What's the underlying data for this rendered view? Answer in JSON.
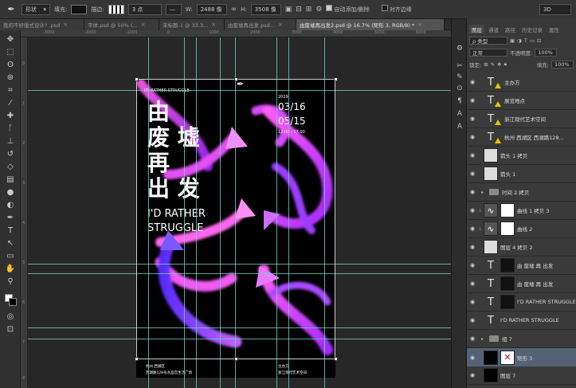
{
  "options_bar": {
    "tool_label": "形状",
    "fill_label": "填充:",
    "stroke_label": "描边:",
    "stroke_width": "3 点",
    "w_label": "W:",
    "w_value": "2488 像",
    "h_label": "H:",
    "h_value": "3508 像",
    "auto_add_label": "自动添加/删除",
    "align_edges_label": "对齐边缘",
    "workspace": "3D"
  },
  "tabs": [
    {
      "label": "我的不好版式设计? .psd",
      "active": false
    },
    {
      "label": "字体.psd @ 50% (...",
      "active": false
    },
    {
      "label": "未标题-1 @ 33.3...",
      "active": false
    },
    {
      "label": "由废墟再出发.psd...",
      "active": false
    },
    {
      "label": "由废墟再出发2.psd @ 16.7% (矩形 3, RGB/8) *",
      "active": true
    }
  ],
  "rulers": {
    "top": [
      "-3000",
      "-2000",
      "-1000",
      "0",
      "1000",
      "2000",
      "3000",
      "4000",
      "5000",
      "6000"
    ],
    "left": [
      "0",
      "1",
      "2",
      "3",
      "4",
      "5",
      "6",
      "7",
      "8"
    ]
  },
  "poster": {
    "tag": "I'D RATHER STRUGGLE",
    "title_lines": [
      "由",
      "废 墟",
      "再",
      "出 发"
    ],
    "english_1": "I'D RATHER",
    "english_2": "STRUGGLE",
    "year": "2019",
    "date_1": "03/16",
    "date_2": "05/15",
    "time": "12:00 - 17:00",
    "foot_left_1": "杭州 西湖区",
    "foot_left_2": "西湖路128号水晶宫生活广场",
    "foot_right_1": "主办方",
    "foot_right_2": "浙江现代艺术空间"
  },
  "panel": {
    "top_dropdown": "3D",
    "tabs": [
      "图层",
      "通道",
      "路径",
      "历史记录",
      "属性"
    ],
    "search_placeholder": "ρ 类型",
    "blend_mode": "正常",
    "opacity_label": "不透明度:",
    "opacity_value": "100%",
    "lock_label": "锁定:",
    "fill_label": "填充:",
    "fill_value": "100%"
  },
  "layers": [
    {
      "name": "主办方",
      "kind": "type",
      "warn": true
    },
    {
      "name": "展览地点",
      "kind": "type",
      "warn": true
    },
    {
      "name": "浙江现代艺术空间",
      "kind": "type",
      "warn": true
    },
    {
      "name": "杭州 西湖区 西湖路128...",
      "kind": "type",
      "warn": true
    },
    {
      "name": "箭头 1 拷贝",
      "kind": "image"
    },
    {
      "name": "箭头 1",
      "kind": "image"
    },
    {
      "name": "时间 2 拷贝",
      "kind": "group"
    },
    {
      "name": "曲线 1 拷贝 3",
      "kind": "adjust"
    },
    {
      "name": "曲线 2",
      "kind": "adjust"
    },
    {
      "name": "图层 4 拷贝 2",
      "kind": "image"
    },
    {
      "name": "由 废墟 再 出发",
      "kind": "type-mask"
    },
    {
      "name": "由 废墟 再 出发",
      "kind": "type-mask"
    },
    {
      "name": "I'D RATHER STRUGGLE",
      "kind": "type-mask"
    },
    {
      "name": "I'D RATHER STRUGGLE",
      "kind": "type"
    },
    {
      "name": "组 7",
      "kind": "group"
    },
    {
      "name": "矩形 3",
      "kind": "shape",
      "selected": true
    },
    {
      "name": "图层 7",
      "kind": "image"
    }
  ],
  "colors": {
    "guide": "#6fcfc5",
    "magenta": "#e040f0",
    "violet": "#7a3cff",
    "selected_layer": "#546276"
  }
}
